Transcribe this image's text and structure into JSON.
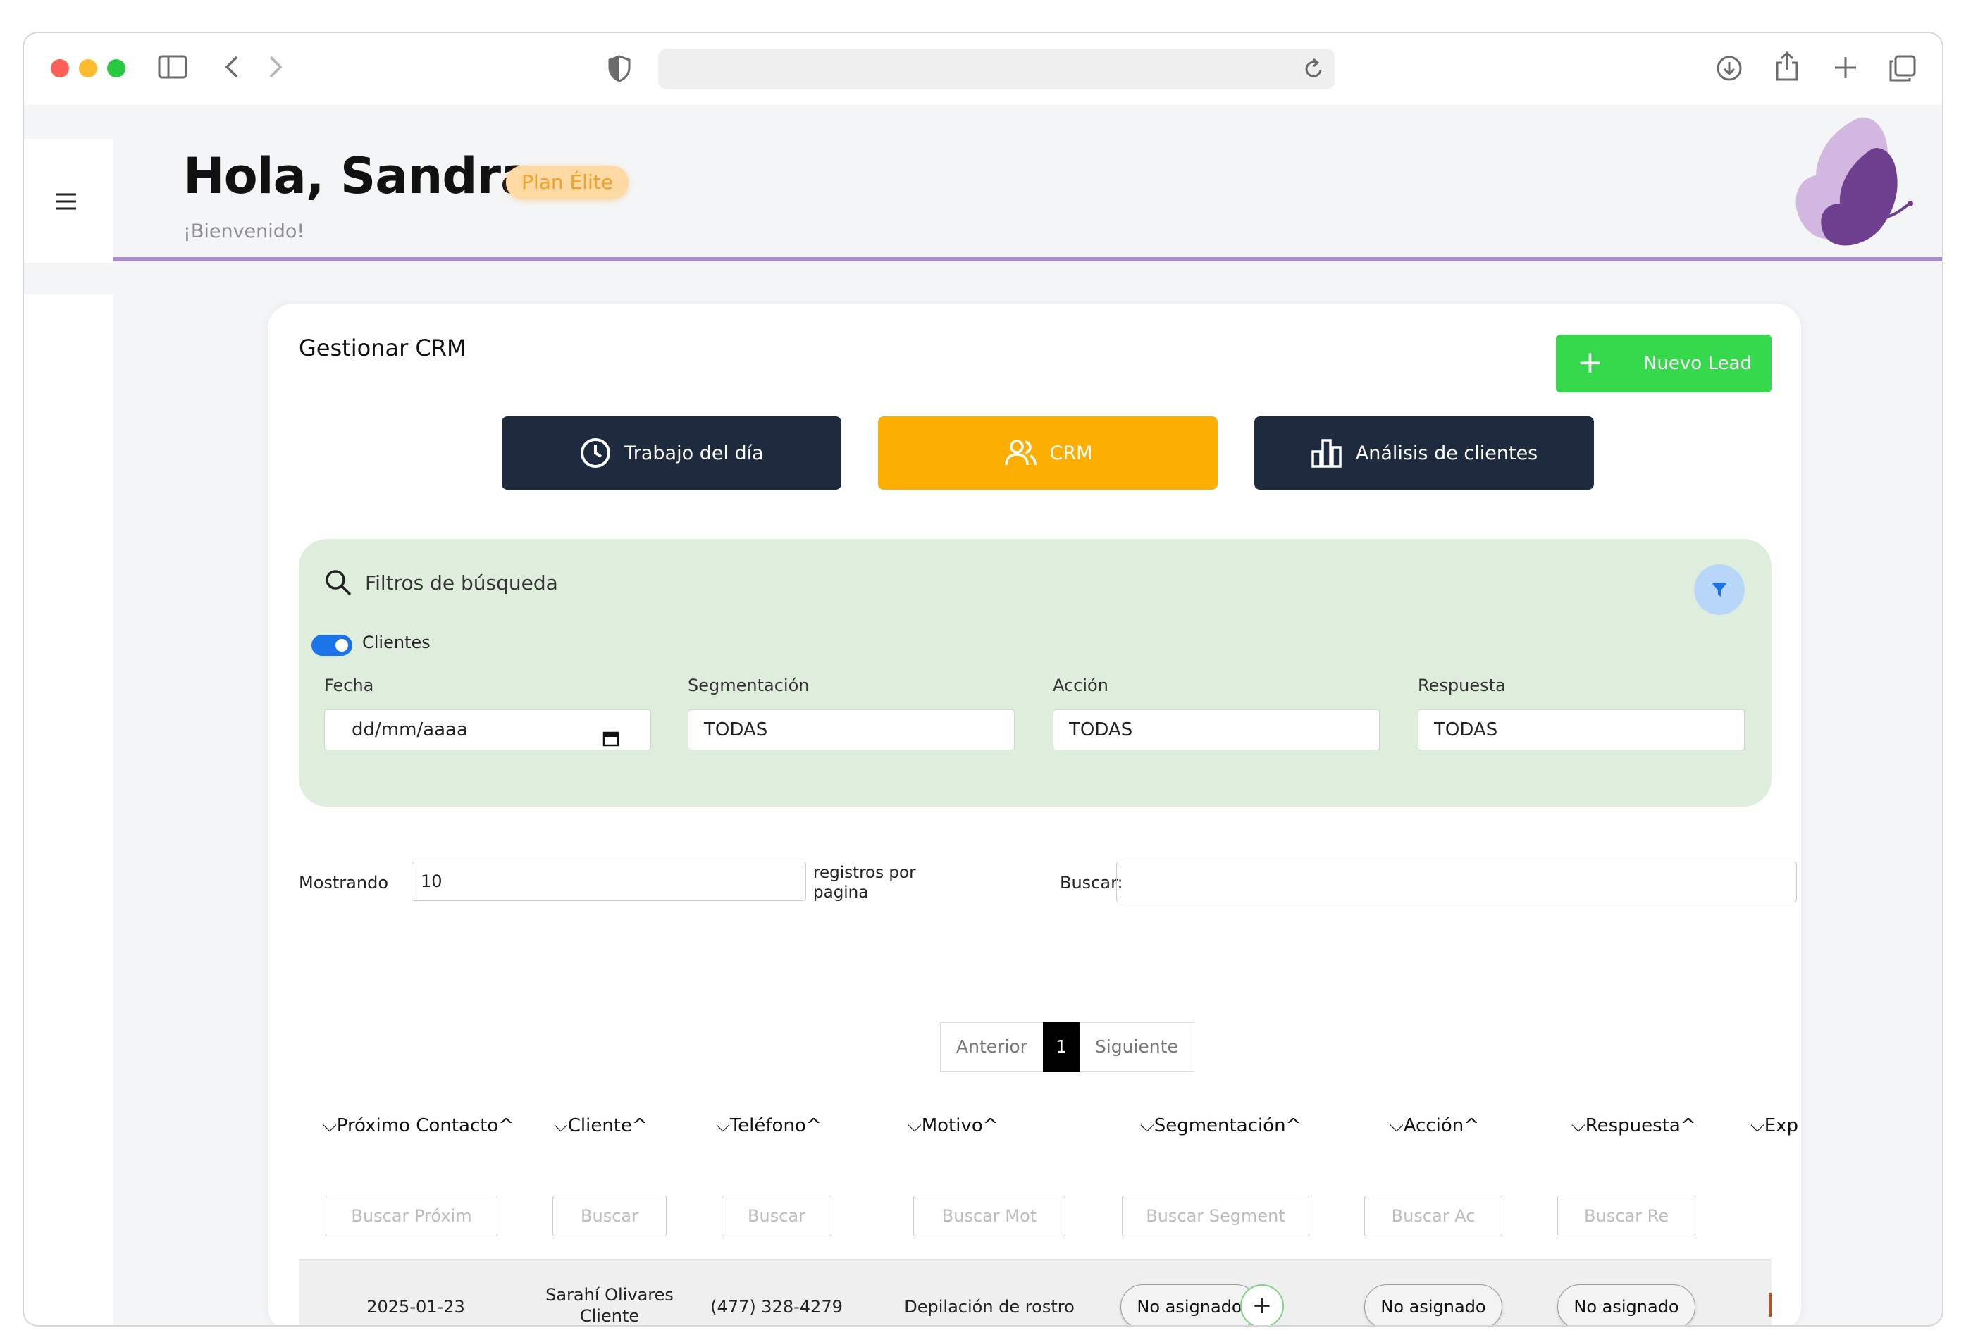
{
  "header": {
    "greeting": "Hola, Sandra",
    "plan_badge": "Plan Élite",
    "welcome": "¡Bienvenido!"
  },
  "card": {
    "title": "Gestionar CRM",
    "new_lead_label": "Nuevo Lead",
    "nav": [
      {
        "label": "Trabajo del día",
        "icon": "clock-icon",
        "color": "#1e2a3d"
      },
      {
        "label": "CRM",
        "icon": "users-icon",
        "color": "#fcae02"
      },
      {
        "label": "Análisis de clientes",
        "icon": "bar-chart-icon",
        "color": "#1e2a3d"
      }
    ]
  },
  "filters": {
    "title": "Filtros de búsqueda",
    "toggle_label": "Clientes",
    "fields": [
      {
        "label": "Fecha",
        "value": "dd/mm/aaaa"
      },
      {
        "label": "Segmentación",
        "value": "TODAS"
      },
      {
        "label": "Acción",
        "value": "TODAS"
      },
      {
        "label": "Respuesta",
        "value": "TODAS"
      }
    ]
  },
  "table_controls": {
    "showing_label": "Mostrando",
    "page_size": "10",
    "per_page_label": "registros por pagina",
    "search_label": "Buscar:"
  },
  "pagination": {
    "prev": "Anterior",
    "current": "1",
    "next": "Siguiente"
  },
  "table": {
    "columns": [
      {
        "label": "Próximo Contacto",
        "search_placeholder": "Buscar Próxim"
      },
      {
        "label": "Cliente",
        "search_placeholder": "Buscar"
      },
      {
        "label": "Teléfono",
        "search_placeholder": "Buscar"
      },
      {
        "label": "Motivo",
        "search_placeholder": "Buscar Mot"
      },
      {
        "label": "Segmentación",
        "search_placeholder": "Buscar Segment"
      },
      {
        "label": "Acción",
        "search_placeholder": "Buscar Ac"
      },
      {
        "label": "Respuesta",
        "search_placeholder": "Buscar Re"
      },
      {
        "label": "Exp",
        "search_placeholder": ""
      }
    ],
    "rows": [
      {
        "proximo_contacto": "2025-01-23",
        "cliente_name": "Sarahí Olivares",
        "cliente_type": "Cliente",
        "telefono": "(477) 328-4279",
        "motivo": "Depilación de rostro",
        "segmentacion": "No asignado",
        "accion": "No asignado",
        "respuesta": "No asignado"
      }
    ]
  },
  "colors": {
    "accent_purple": "#a98bc9",
    "new_lead_green": "#36d84c",
    "filters_bg": "#dfeedc",
    "badge_text": "#f4a12a"
  }
}
